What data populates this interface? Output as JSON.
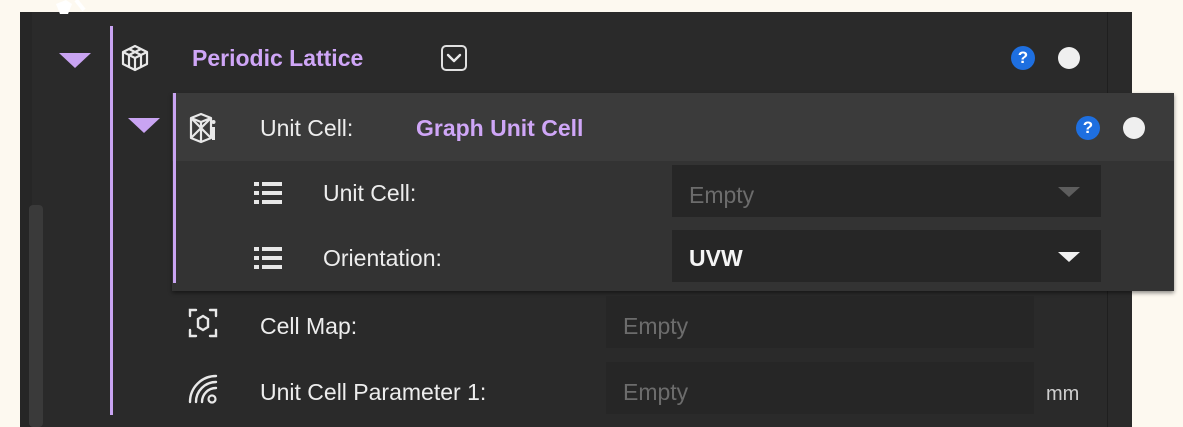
{
  "colors": {
    "accent": "#c9a4f2",
    "help": "#1e6fe0",
    "panel": "#2a2a2a"
  },
  "lattice": {
    "title": "Periodic Lattice",
    "icon": "lattice-cube-icon",
    "help": "?"
  },
  "unit_cell": {
    "label": "Unit Cell:",
    "value": "Graph Unit Cell",
    "icon": "unit-cell-icon",
    "help": "?",
    "fields": [
      {
        "icon": "list-icon",
        "label": "Unit Cell:",
        "value": "Empty"
      },
      {
        "icon": "list-icon",
        "label": "Orientation:",
        "value": "UVW"
      }
    ]
  },
  "cell_map": {
    "icon": "cell-map-icon",
    "label": "Cell Map:",
    "value": "Empty"
  },
  "parameter": {
    "icon": "field-icon",
    "label": "Unit Cell Parameter 1:",
    "value": "Empty",
    "unit": "mm"
  }
}
